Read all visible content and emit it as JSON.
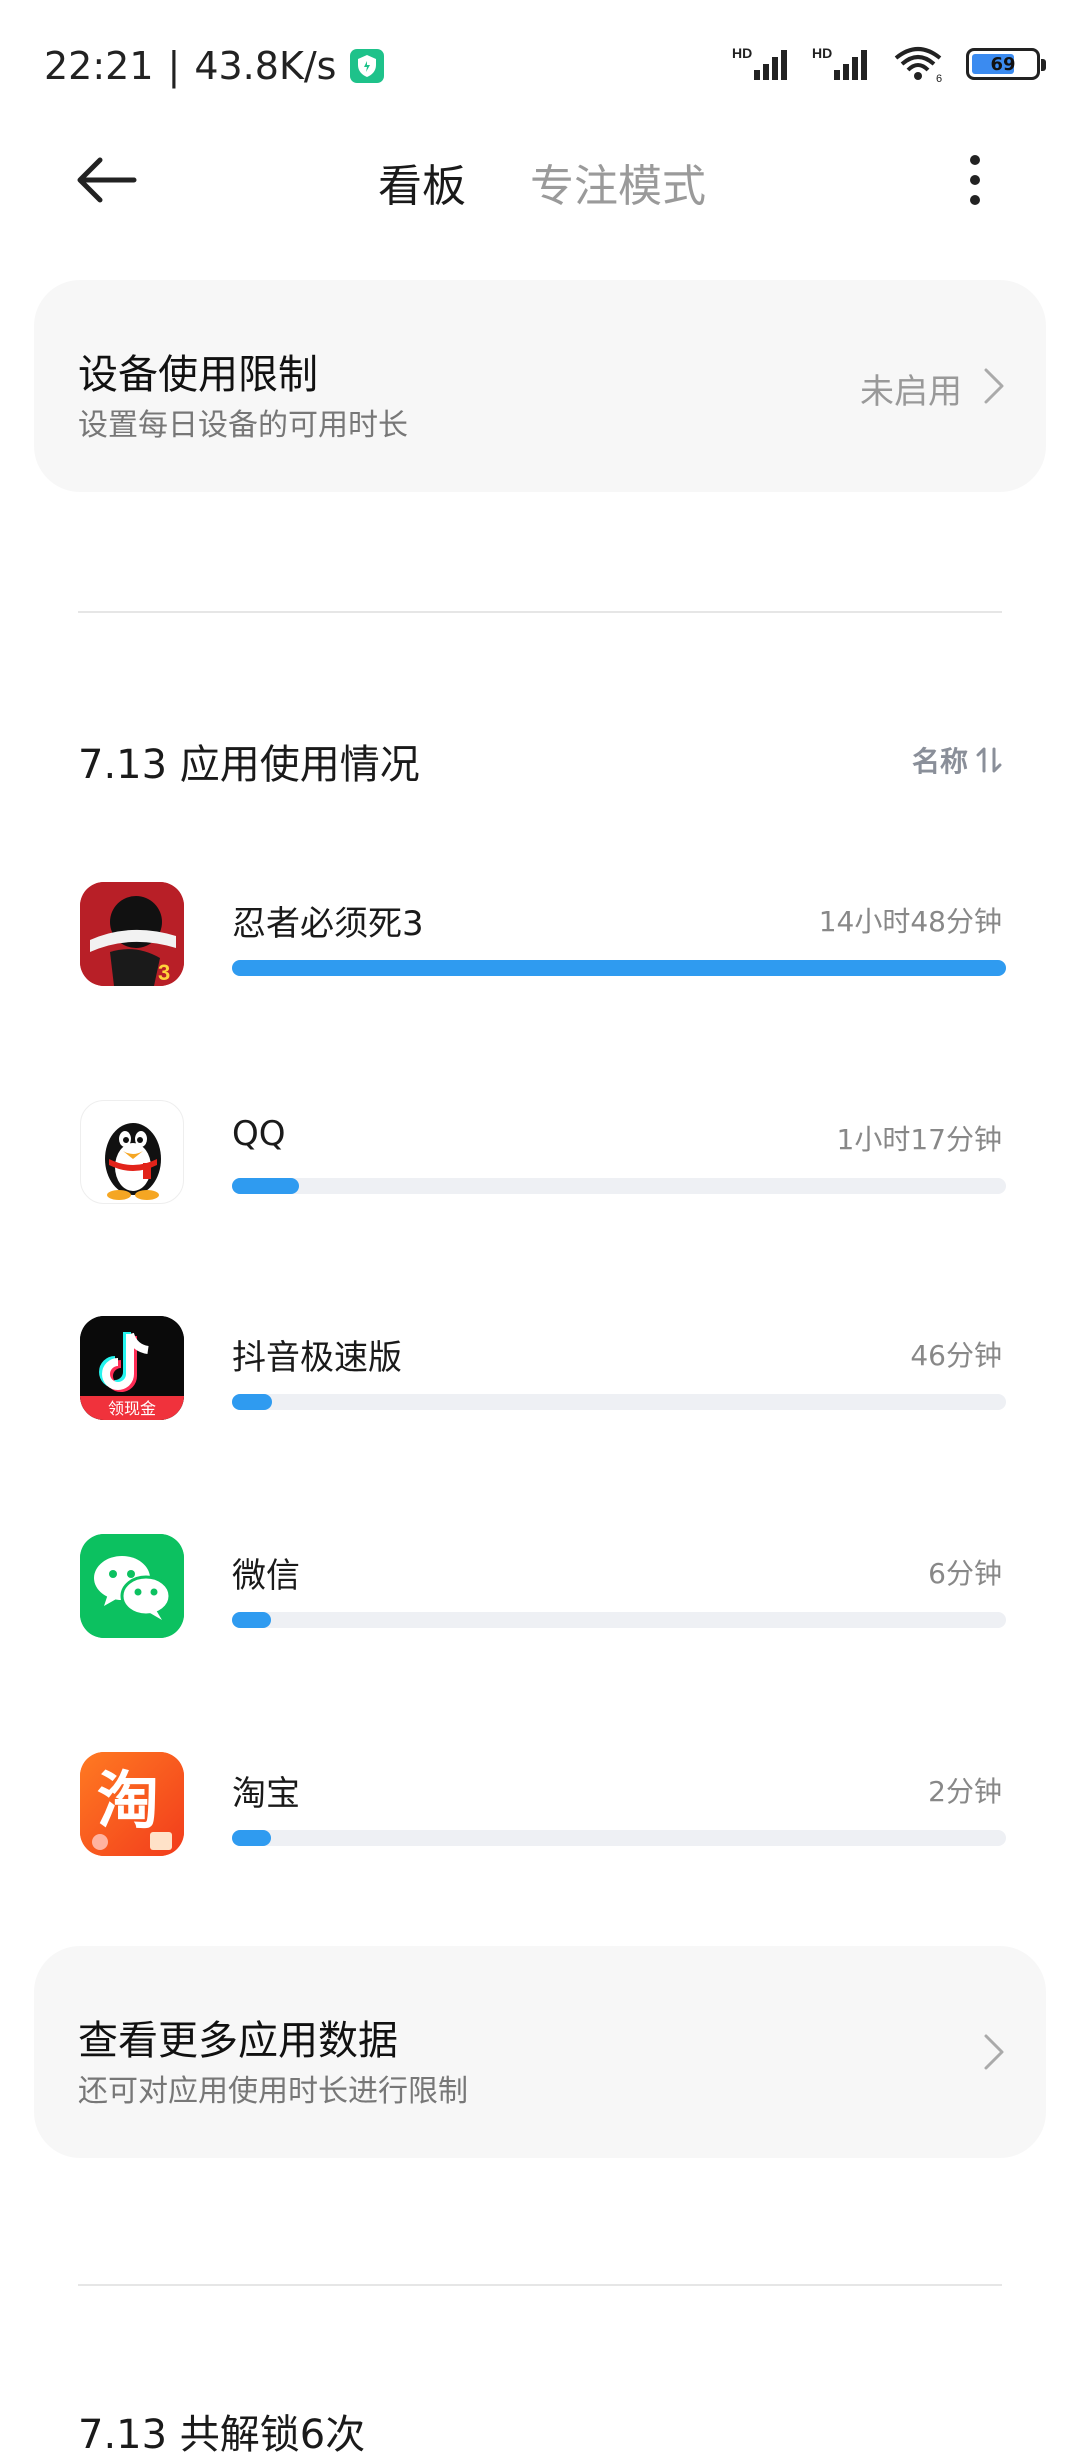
{
  "status_bar": {
    "time": "22:21",
    "net_speed": "43.8K/s",
    "battery": "69"
  },
  "header": {
    "tab_board": "看板",
    "tab_focus": "专注模式"
  },
  "device_limit": {
    "title": "设备使用限制",
    "subtitle": "设置每日设备的可用时长",
    "status": "未启用"
  },
  "usage": {
    "title": "7.13 应用使用情况",
    "sort_label": "名称"
  },
  "apps": [
    {
      "name": "忍者必须死3",
      "time": "14小时48分钟",
      "fraction": 1.0
    },
    {
      "name": "QQ",
      "time": "1小时17分钟",
      "fraction": 0.087
    },
    {
      "name": "抖音极速版",
      "time": "46分钟",
      "fraction": 0.052
    },
    {
      "name": "微信",
      "time": "6分钟",
      "fraction": 0.05
    },
    {
      "name": "淘宝",
      "time": "2分钟",
      "fraction": 0.05
    }
  ],
  "more_apps": {
    "title": "查看更多应用数据",
    "subtitle": "还可对应用使用时长进行限制"
  },
  "unlock": {
    "title": "7.13 共解锁6次"
  },
  "icons": {
    "douyin_badge": "领现金",
    "taobao_char": "淘"
  },
  "colors": {
    "accent": "#2f9bf0",
    "track": "#eef0f4",
    "card": "#f7f7f7"
  }
}
